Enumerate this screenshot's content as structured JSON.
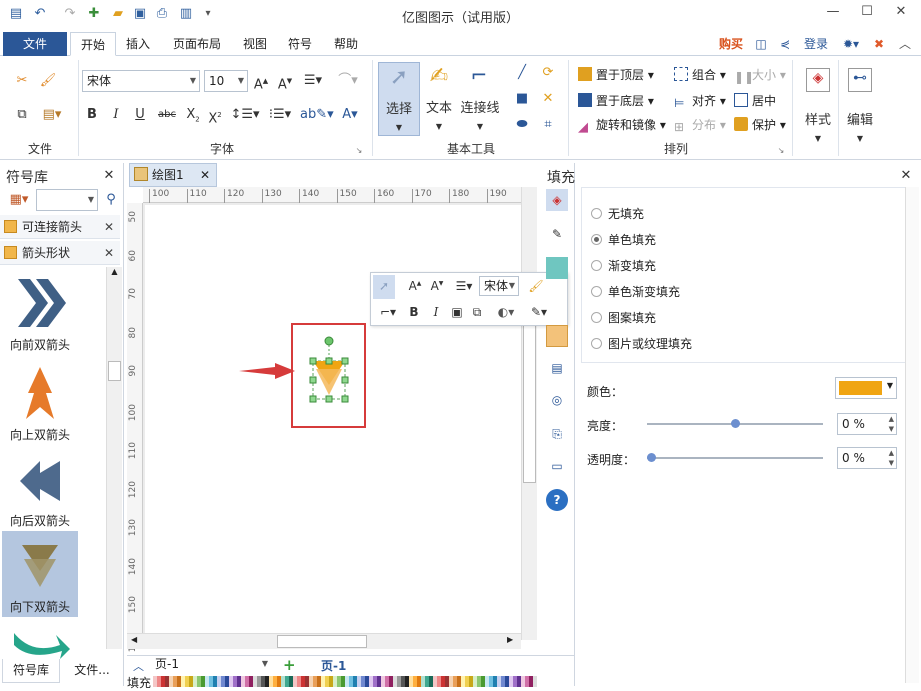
{
  "app": {
    "title": "亿图图示（试用版）",
    "menu_file": "文件",
    "tabs": [
      "开始",
      "插入",
      "页面布局",
      "视图",
      "符号",
      "帮助"
    ],
    "buy": "购买",
    "login": "登录"
  },
  "ribbon": {
    "groups": {
      "file": "文件",
      "font": "字体",
      "tools": "基本工具",
      "arrange": "排列"
    },
    "font_name": "宋体",
    "font_size": "10",
    "tools": {
      "select": "选择",
      "text": "文本",
      "connector": "连接线"
    },
    "arrange": {
      "bring_front": "置于顶层",
      "send_back": "置于底层",
      "rotate_mirror": "旋转和镜像",
      "group": "组合",
      "align": "对齐",
      "distribute": "分布",
      "size": "大小",
      "center": "居中",
      "protect": "保护"
    },
    "style": "样式",
    "edit": "编辑"
  },
  "left_panel": {
    "title": "符号库",
    "categories": [
      "可连接箭头",
      "箭头形状"
    ],
    "shapes": [
      "向前双箭头",
      "向上双箭头",
      "向后双箭头",
      "向下双箭头"
    ],
    "bottom_tabs": [
      "符号库",
      "文件..."
    ]
  },
  "canvas": {
    "doc_tab": "绘图1",
    "ruler_h": [
      "100",
      "110",
      "120",
      "130",
      "140",
      "150",
      "160",
      "170",
      "180",
      "190"
    ],
    "ruler_v": [
      "50",
      "60",
      "70",
      "80",
      "90",
      "100",
      "110",
      "120",
      "130",
      "140",
      "150",
      "160"
    ],
    "float_font": "宋体",
    "page_name": "页-1",
    "page_tab": "页-1",
    "fill_label": "填充"
  },
  "right_panel": {
    "title": "填充",
    "options": [
      "无填充",
      "单色填充",
      "渐变填充",
      "单色渐变填充",
      "图案填充",
      "图片或纹理填充"
    ],
    "selected_index": 1,
    "color_label": "颜色：",
    "color_value": "#f0a513",
    "brightness_label": "亮度：",
    "brightness_value": "0 %",
    "brightness_level": 0.5,
    "transparency_label": "透明度：",
    "transparency_value": "0 %",
    "transparency_level": 0.0
  },
  "colors": {
    "accent": "#2b5797",
    "highlight_box": "#d63b3b",
    "arrow_shape": "#f0a513"
  }
}
